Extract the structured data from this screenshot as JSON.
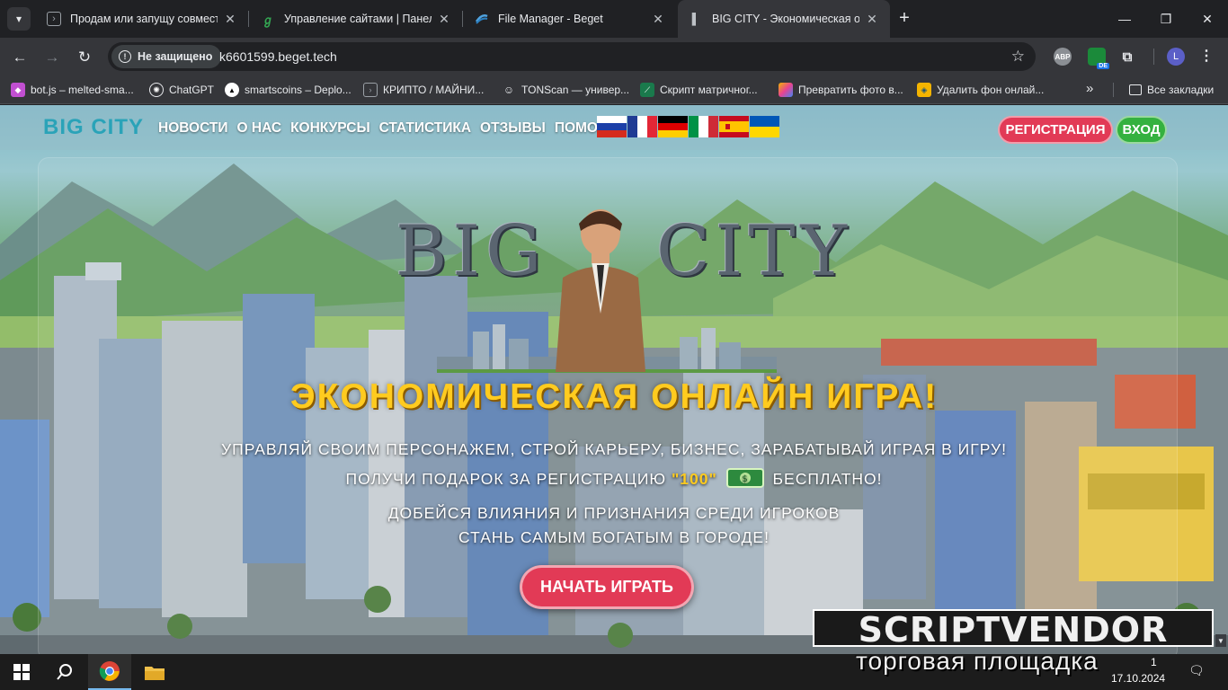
{
  "tabs": [
    {
      "title": "Продам или запущу совместн",
      "icon": "terminal-icon",
      "active": false
    },
    {
      "title": "Управление сайтами | Панель",
      "icon": "beget-panel-icon",
      "active": false
    },
    {
      "title": "File Manager - Beget",
      "icon": "file-manager-icon",
      "active": false
    },
    {
      "title": "BIG CITY - Экономическая онл",
      "icon": "globe-icon",
      "active": true
    }
  ],
  "toolbar": {
    "security_label": "Не защищено",
    "url": "k6601599.beget.tech",
    "ext_abp_label": "ABP",
    "ext_de_label": "DE",
    "profile_initial": "L"
  },
  "bookmarks": [
    {
      "label": "bot.js – melted-sma...",
      "icon": "glitch-icon",
      "color": "#c14fd1"
    },
    {
      "label": "ChatGPT",
      "icon": "chatgpt-icon",
      "color": "#202124"
    },
    {
      "label": "smartscoins – Deplo...",
      "icon": "vercel-icon",
      "color": "#000000"
    },
    {
      "label": "КРИПТО / МАЙНИ...",
      "icon": "terminal-icon",
      "color": "#202124"
    },
    {
      "label": "TONScan — универ...",
      "icon": "tonscan-icon",
      "color": "#202124"
    },
    {
      "label": "Скрипт матричног...",
      "icon": "script-icon",
      "color": "#1a7a4c"
    },
    {
      "label": "Превратить фото в...",
      "icon": "photo-icon",
      "color": "#e84393"
    },
    {
      "label": "Удалить фон онлай...",
      "icon": "remove-bg-icon",
      "color": "#f4b400"
    }
  ],
  "bookmarks_all": "Все закладки",
  "site": {
    "logo": "BIG CITY",
    "nav": [
      "НОВОСТИ",
      "О НАС",
      "КОНКУРСЫ",
      "СТАТИСТИКА",
      "ОТЗЫВЫ",
      "ПОМОЩЬ"
    ],
    "flags": [
      "ru",
      "fr",
      "de",
      "it",
      "es",
      "ua"
    ],
    "register": "РЕГИСТРАЦИЯ",
    "login": "ВХОД",
    "hero_logo_left": "BIG",
    "hero_logo_right": "CITY",
    "headline": "ЭКОНОМИЧЕСКАЯ ОНЛАЙН ИГРА!",
    "line1": "УПРАВЛЯЙ СВОИМ ПЕРСОНАЖЕМ, СТРОЙ КАРЬЕРУ, БИЗНЕС, ЗАРАБАТЫВАЙ ИГРАЯ В ИГРУ!",
    "line2_prefix": "ПОЛУЧИ ПОДАРОК ЗА РЕГИСТРАЦИЮ",
    "line2_gift": "\"100\"",
    "line2_suffix": "БЕСПЛАТНО!",
    "line3": "ДОБЕЙСЯ ВЛИЯНИЯ И ПРИЗНАНИЯ СРЕДИ ИГРОКОВ",
    "line4": "СТАНЬ САМЫМ БОГАТЫМ В ГОРОДЕ!",
    "play": "НАЧАТЬ ИГРАТЬ"
  },
  "watermark": {
    "top": "SCRIPTVENDOR",
    "bottom": "торговая площадка"
  },
  "taskbar": {
    "time": "1",
    "date": "17.10.2024"
  }
}
